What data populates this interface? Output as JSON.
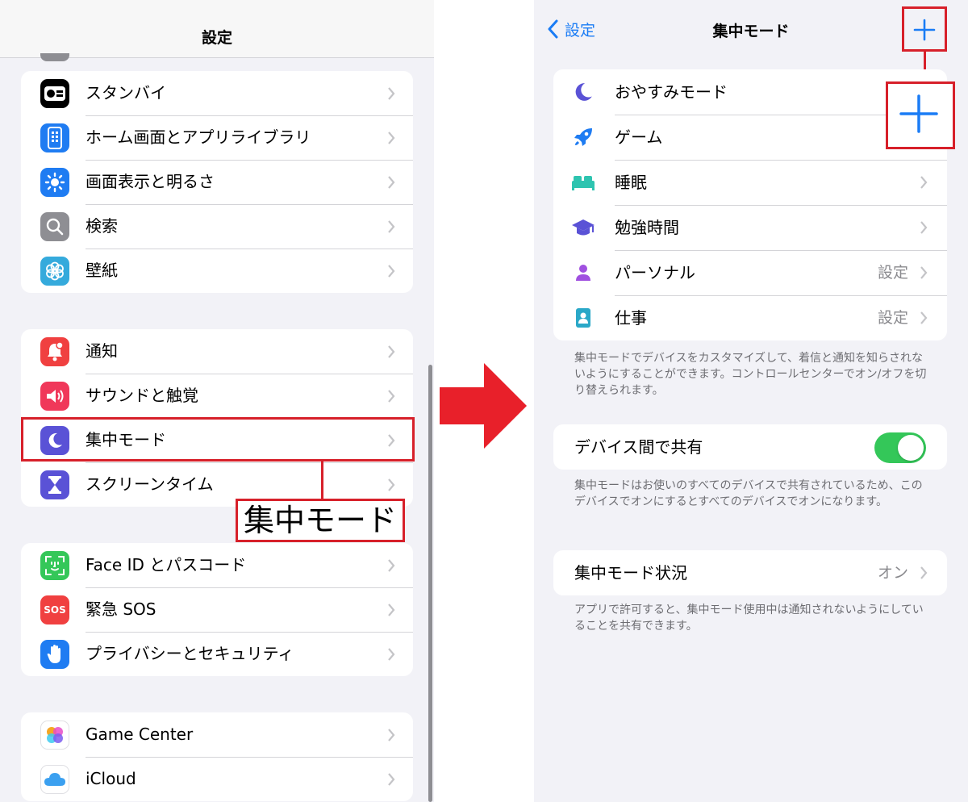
{
  "left": {
    "nav_title": "設定",
    "groups": [
      {
        "items": [
          {
            "label": "スタンバイ",
            "icon": "standby-icon",
            "color": "#000000"
          },
          {
            "label": "ホーム画面とアプリライブラリ",
            "icon": "home-screen-icon",
            "color": "#1f7cf2"
          },
          {
            "label": "画面表示と明るさ",
            "icon": "brightness-icon",
            "color": "#1f7cf2"
          },
          {
            "label": "検索",
            "icon": "search-icon",
            "color": "#8e8e93"
          },
          {
            "label": "壁紙",
            "icon": "wallpaper-icon",
            "color": "#35aadc"
          }
        ]
      },
      {
        "items": [
          {
            "label": "通知",
            "icon": "bell-icon",
            "color": "#f04040"
          },
          {
            "label": "サウンドと触覚",
            "icon": "speaker-icon",
            "color": "#f0385a"
          },
          {
            "label": "集中モード",
            "icon": "moon-icon",
            "color": "#5a52d6"
          },
          {
            "label": "スクリーンタイム",
            "icon": "hourglass-icon",
            "color": "#5a52d6"
          }
        ]
      },
      {
        "items": [
          {
            "label": "Face ID とパスコード",
            "icon": "face-id-icon",
            "color": "#34c759"
          },
          {
            "label": "緊急 SOS",
            "icon": "sos-icon",
            "color": "#f04040",
            "badge": "SOS"
          },
          {
            "label": "プライバシーとセキュリティ",
            "icon": "hand-icon",
            "color": "#1f7cf2"
          }
        ]
      },
      {
        "items": [
          {
            "label": "Game Center",
            "icon": "game-center-icon",
            "color": "#ffffff"
          },
          {
            "label": "iCloud",
            "icon": "icloud-icon",
            "color": "#ffffff"
          }
        ]
      }
    ],
    "callout_text": "集中モード"
  },
  "right": {
    "back_label": "設定",
    "nav_title": "集中モード",
    "focus_items": [
      {
        "label": "おやすみモード",
        "icon": "moon-icon",
        "icon_color": "#5a52d6",
        "value": ""
      },
      {
        "label": "ゲーム",
        "icon": "rocket-icon",
        "icon_color": "#1f7cf2",
        "value": ""
      },
      {
        "label": "睡眠",
        "icon": "bed-icon",
        "icon_color": "#2ec4b0",
        "value": ""
      },
      {
        "label": "勉強時間",
        "icon": "graduation-cap-icon",
        "icon_color": "#5a52d6",
        "value": ""
      },
      {
        "label": "パーソナル",
        "icon": "person-icon",
        "icon_color": "#a050e0",
        "value": "設定"
      },
      {
        "label": "仕事",
        "icon": "id-badge-icon",
        "icon_color": "#2aa8c8",
        "value": "設定"
      }
    ],
    "focus_note": "集中モードでデバイスをカスタマイズして、着信と通知を知らされないようにすることができます。コントロールセンターでオン/オフを切り替えられます。",
    "share_label": "デバイス間で共有",
    "share_on": true,
    "share_note": "集中モードはお使いのすべてのデバイスで共有されているため、このデバイスでオンにするとすべてのデバイスでオンになります。",
    "status_label": "集中モード状況",
    "status_value": "オン",
    "status_note": "アプリで許可すると、集中モード使用中は通知されないようにしていることを共有できます。"
  },
  "colors": {
    "highlight": "#d7202a",
    "accent": "#1a7cf5",
    "toggle_on": "#34c759"
  }
}
